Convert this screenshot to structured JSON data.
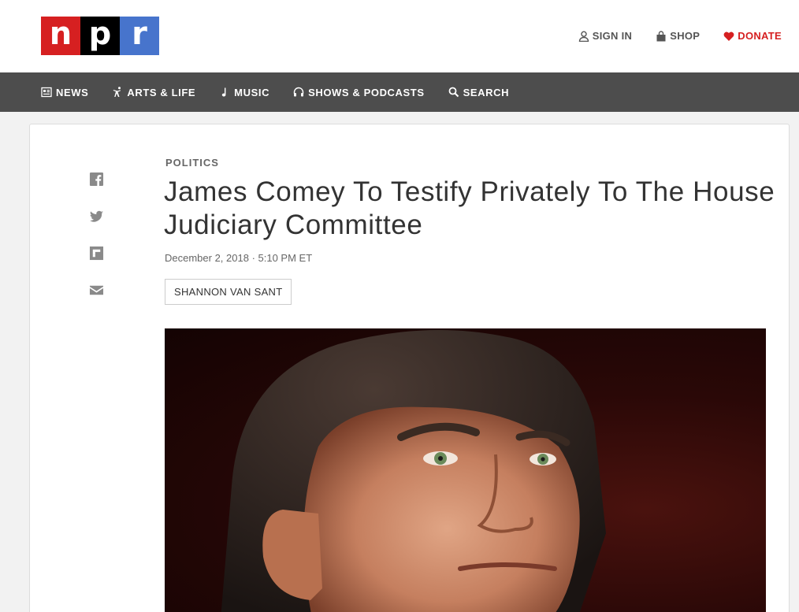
{
  "brand": {
    "letters": [
      "n",
      "p",
      "r"
    ]
  },
  "header": {
    "links": [
      {
        "label": "SIGN IN",
        "icon": "user-icon"
      },
      {
        "label": "SHOP",
        "icon": "shopping-bag-icon"
      },
      {
        "label": "DONATE",
        "icon": "heart-icon"
      }
    ]
  },
  "nav": {
    "items": [
      {
        "label": "NEWS",
        "icon": "newspaper-icon"
      },
      {
        "label": "ARTS & LIFE",
        "icon": "dancer-icon"
      },
      {
        "label": "MUSIC",
        "icon": "music-note-icon"
      },
      {
        "label": "SHOWS & PODCASTS",
        "icon": "headphones-icon"
      },
      {
        "label": "SEARCH",
        "icon": "search-icon"
      }
    ]
  },
  "share": [
    "facebook-icon",
    "twitter-icon",
    "flipboard-icon",
    "email-icon"
  ],
  "article": {
    "slug": "POLITICS",
    "headline": "James Comey To Testify Privately To The House Judiciary Committee",
    "date": "December 2, 2018 · 5:10 PM ET",
    "byline": "SHANNON VAN SANT"
  },
  "colors": {
    "brand_red": "#d62021",
    "brand_blue": "#4774cc",
    "nav_bg": "#4d4d4d"
  }
}
